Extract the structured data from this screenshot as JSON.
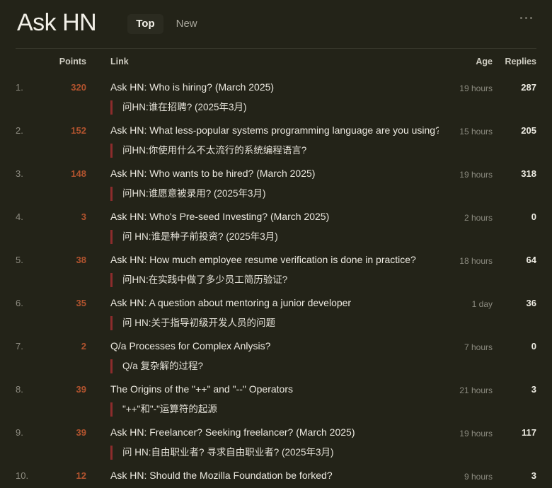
{
  "header": {
    "title": "Ask HN",
    "tabs": [
      {
        "label": "Top",
        "active": true
      },
      {
        "label": "New",
        "active": false
      }
    ],
    "menu_icon": "kebab-horizontal-icon"
  },
  "colors": {
    "background": "#232318",
    "points": "#b1532e",
    "accent_bar": "#8d2c2c",
    "text": "#ece9e0",
    "muted": "#8b8a7f",
    "divider": "#36362a"
  },
  "columns": {
    "rank": "",
    "points": "Points",
    "link": "Link",
    "age": "Age",
    "replies": "Replies"
  },
  "rows": [
    {
      "rank": "1.",
      "points": "320",
      "title": "Ask HN: Who is hiring? (March 2025)",
      "translation": "问HN:谁在招聘? (2025年3月)",
      "age": "19 hours",
      "replies": "287"
    },
    {
      "rank": "2.",
      "points": "152",
      "title": "Ask HN: What less-popular systems programming language are you using?",
      "translation": "问HN:你使用什么不太流行的系统编程语言?",
      "age": "15 hours",
      "replies": "205"
    },
    {
      "rank": "3.",
      "points": "148",
      "title": "Ask HN: Who wants to be hired? (March 2025)",
      "translation": "问HN:谁愿意被录用? (2025年3月)",
      "age": "19 hours",
      "replies": "318"
    },
    {
      "rank": "4.",
      "points": "3",
      "title": "Ask HN: Who's Pre-seed Investing? (March 2025)",
      "translation": "问 HN:谁是种子前投资? (2025年3月)",
      "age": "2 hours",
      "replies": "0"
    },
    {
      "rank": "5.",
      "points": "38",
      "title": "Ask HN: How much employee resume verification is done in practice?",
      "translation": "问HN:在实践中做了多少员工简历验证?",
      "age": "18 hours",
      "replies": "64"
    },
    {
      "rank": "6.",
      "points": "35",
      "title": "Ask HN: A question about mentoring a junior developer",
      "translation": "问 HN:关于指导初级开发人员的问题",
      "age": "1 day",
      "replies": "36"
    },
    {
      "rank": "7.",
      "points": "2",
      "title": "Q/a Processes for Complex Anlysis?",
      "translation": "Q/a 复杂解的过程?",
      "age": "7 hours",
      "replies": "0"
    },
    {
      "rank": "8.",
      "points": "39",
      "title": "The Origins of the \"++\" and \"--\" Operators",
      "translation": "\"++\"和\"-\"运算符的起源",
      "age": "21 hours",
      "replies": "3"
    },
    {
      "rank": "9.",
      "points": "39",
      "title": "Ask HN: Freelancer? Seeking freelancer? (March 2025)",
      "translation": "问 HN:自由职业者? 寻求自由职业者? (2025年3月)",
      "age": "19 hours",
      "replies": "117"
    },
    {
      "rank": "10.",
      "points": "12",
      "title": "Ask HN: Should the Mozilla Foundation be forked?",
      "translation": "",
      "age": "9 hours",
      "replies": "3"
    }
  ]
}
